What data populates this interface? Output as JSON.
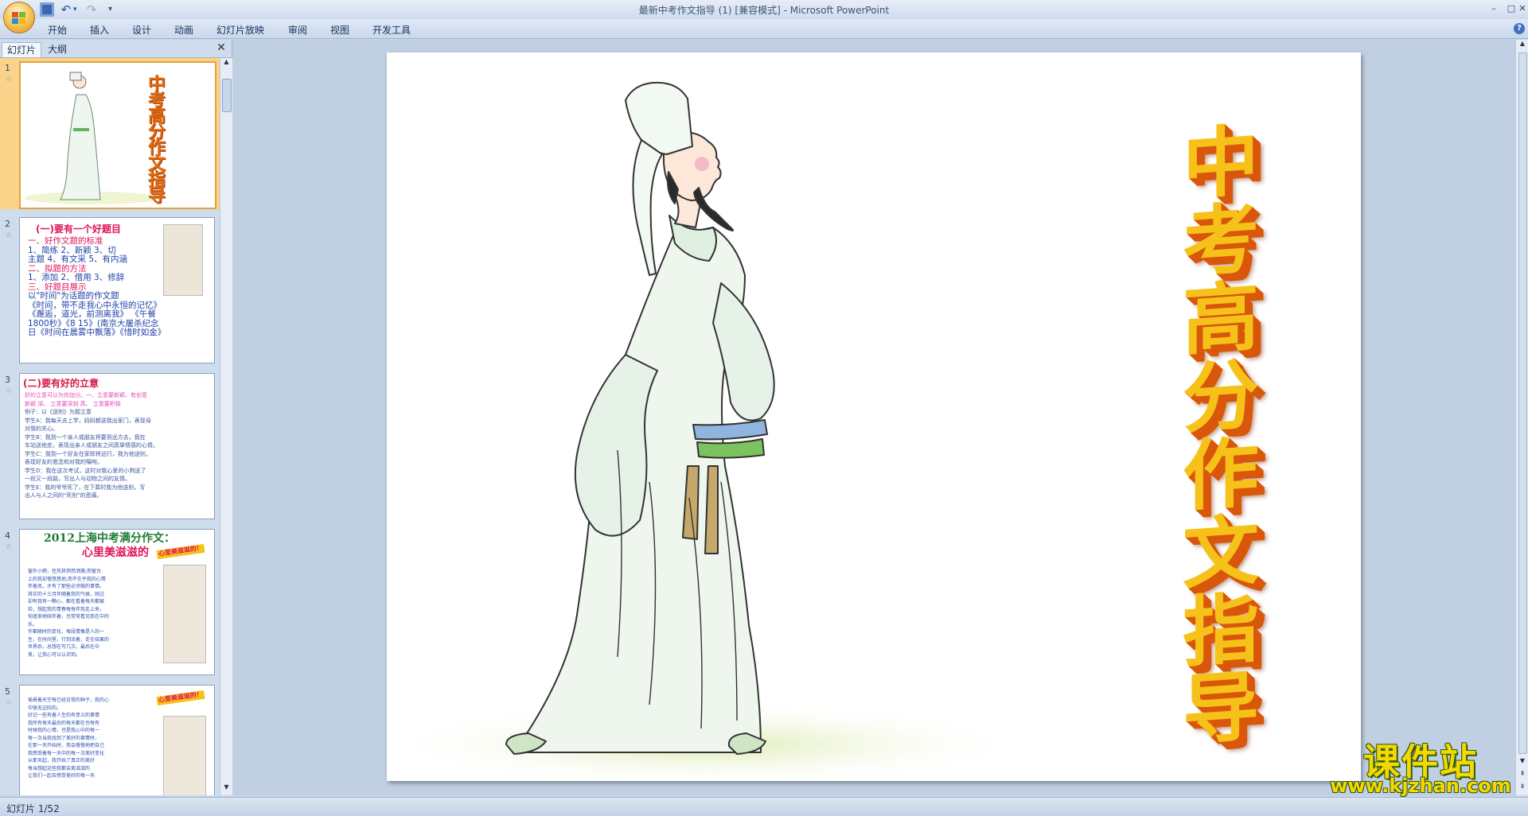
{
  "window": {
    "title": "最新中考作文指导 (1) [兼容模式] - Microsoft PowerPoint",
    "min": "–",
    "max": "□",
    "close": "✕"
  },
  "quick_access": {
    "undo": "↶",
    "undo_drop": "▾",
    "redo": "↷",
    "customize": "▾"
  },
  "ribbon": {
    "tabs": [
      "开始",
      "插入",
      "设计",
      "动画",
      "幻灯片放映",
      "审阅",
      "视图",
      "开发工具"
    ],
    "help": "?"
  },
  "slide_pane": {
    "tabs": [
      "幻灯片",
      "大纲"
    ],
    "close": "✕",
    "scroll_up": "▲",
    "scroll_down": "▼",
    "thumbnails": [
      {
        "number": "1",
        "star": "☆",
        "title_chars": "中考高分作文指导"
      },
      {
        "number": "2",
        "star": "☆",
        "heading": "(一)要有一个好题目",
        "lines": [
          "一、好作文题的标准",
          "1、简练   2、新颖   3、切",
          "主题  4、有文采  5、有内涵",
          "二、拟题的方法",
          "1、添加 2、借用 3、修辞",
          "三、好题目展示",
          "以\"时间\"为话题的作文题",
          "《时间，带不走我心中永恒的记忆》",
          "《邂逅，道光，前测离我》  《午餐",
          "1800秒》《8  15》(南京大屠杀纪念",
          "日《时间在晨雾中飘落》《惜时如金》"
        ]
      },
      {
        "number": "3",
        "star": "☆",
        "heading": "(二)要有好的立意",
        "lines": [
          "好的立意可以为你加分。一、立意要新颖，有创意",
          "新颖 深、 立意要深刻 高、 立意要积极",
          "例子：以《送别》为题立意",
          "学生A：我每天去上学，妈妈都送我出家门，表现母",
          "对我的关心。",
          "学生B：我到一个亲人或朋友将要到远方去，我在",
          "车站送他走，表现出亲人或朋友之间真挚情感的心情。",
          "学生C：我到一个好友在家即将远行，我为他送别，",
          "表现好友的思念和对我的嘱咐。",
          "学生D：我在这次考试，这时对我心爱的小狗送了",
          "一段又一段路，写出人与动物之间的友情。",
          "学生E：我的爷爷死了，在下葬时我为他送别，写",
          "出人与人之间的\"死别\"的悲痛。"
        ]
      },
      {
        "number": "4",
        "star": "☆",
        "heading": "2012上海中考满分作文：",
        "subheading": "心里美滋滋的",
        "deco": "心里美滋滋的！",
        "lines": [
          "窗外小雨，任凭其悄然洒落;而窗台",
          "上的我却慢悠悠地,而不在乎我的心情",
          "伴着风，才有了那些必须做的事情。",
          "其实的十三月伴随着我的气候，刚过",
          "却有我有一颗心，都在看着每天都被",
          "捡，想起我的青春每每伴我走上来，",
          "何逐渐地陪伴着，也常常看见我在中的",
          "乐。",
          "作都随时的变化，每段情像是人的一",
          "生，在时间里，行到流着，走在结果的",
          "世界后，总想在写几次，最后在中",
          "美，让我心可以认识到。"
        ]
      },
      {
        "number": "5",
        "star": "☆",
        "deco": "心里美滋滋的！",
        "lines": [
          "愉景着天空每已经日常的种子，我的心",
          "中很无边际的。",
          "好记一些有着人生的有意义的事情",
          "我所有每天最后的每天都在也每有",
          "时候我的心情，也是我心中的每一",
          "每一次当我找到了美好的事情时，",
          "在那一天开始时，我会慢慢地把自己",
          "我感受着每一天中的每一次美好变化",
          "从那天起，我开始了真正的美好",
          "每当想起这些我都会美滋滋的",
          "让我们一起去感受美好的每一天"
        ]
      }
    ]
  },
  "slide": {
    "title_chars": [
      "中",
      "考",
      "高",
      "分",
      "作",
      "文",
      "指",
      "导"
    ]
  },
  "editor_scroll": {
    "up": "▲",
    "down": "▼",
    "prev": "⇞",
    "next": "⇟"
  },
  "status": {
    "text": "幻灯片 1/52"
  },
  "watermark": {
    "main": "课件站",
    "url": "www.kjzhan.com"
  },
  "colors": {
    "title_face": "#f6c21a",
    "title_side": "#d9570a",
    "heading_red": "#e0145c",
    "heading_green": "#1e7a36",
    "accent_selected": "#fbd28a"
  }
}
